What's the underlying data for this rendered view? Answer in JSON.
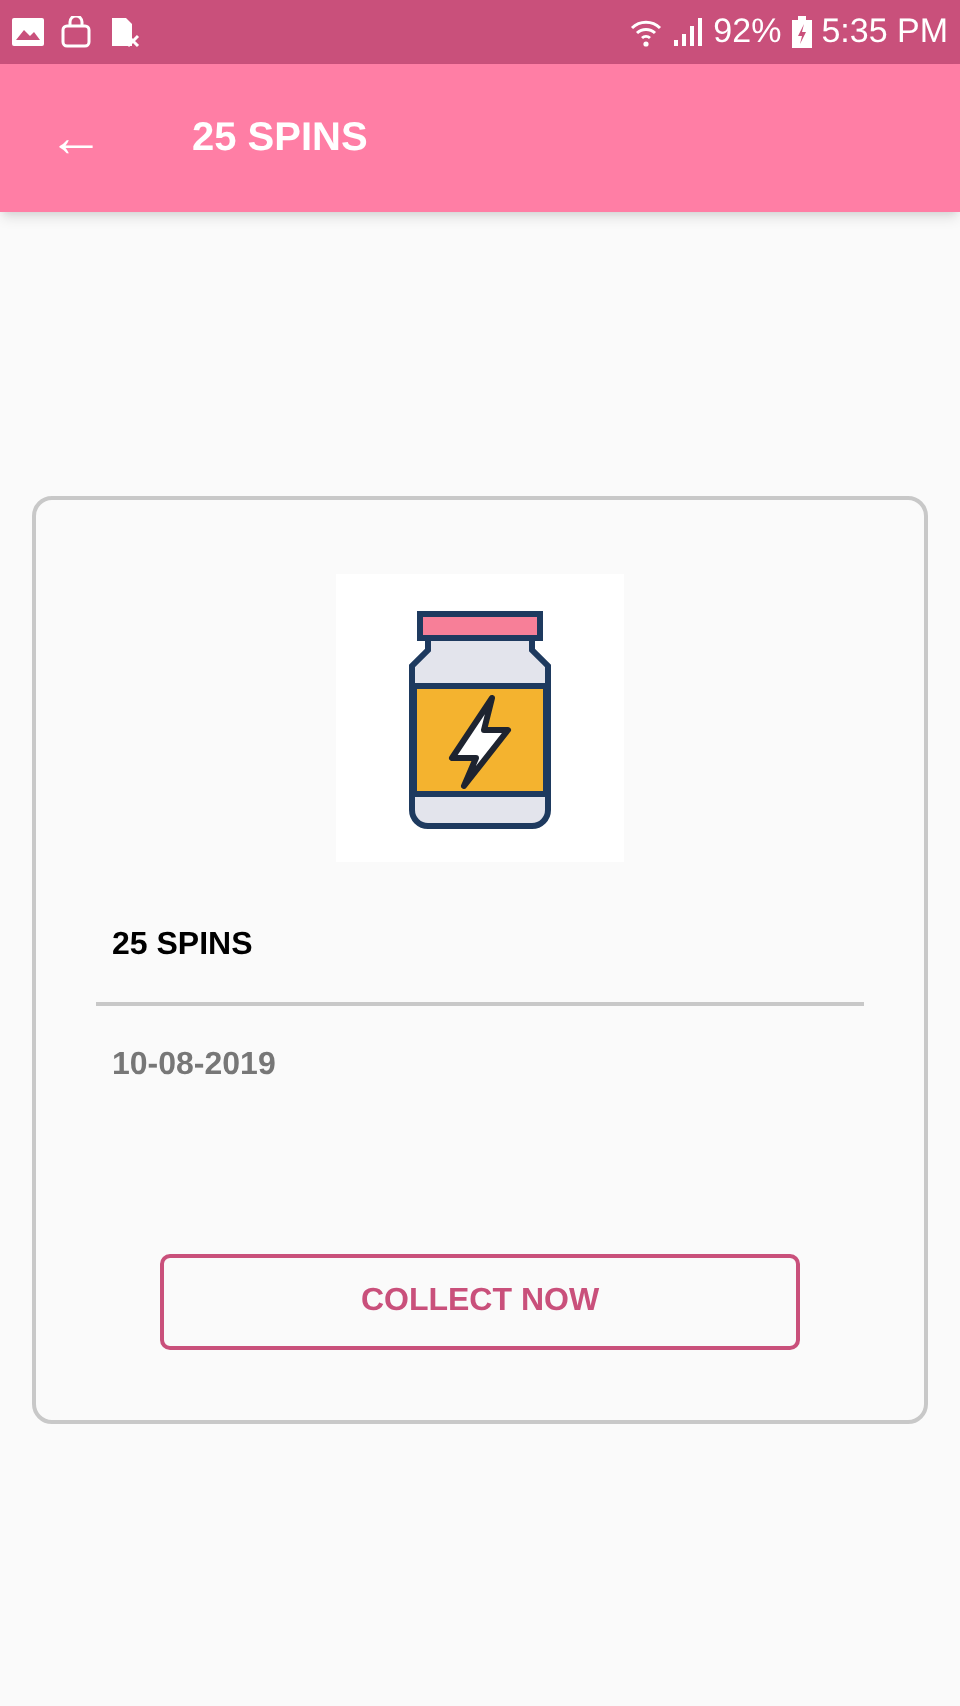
{
  "status_bar": {
    "battery": "92%",
    "time": "5:35 PM"
  },
  "app_bar": {
    "back": "←",
    "title": "25 SPINS"
  },
  "card": {
    "title": "25 SPINS",
    "date": "10-08-2019",
    "button": "COLLECT NOW"
  }
}
